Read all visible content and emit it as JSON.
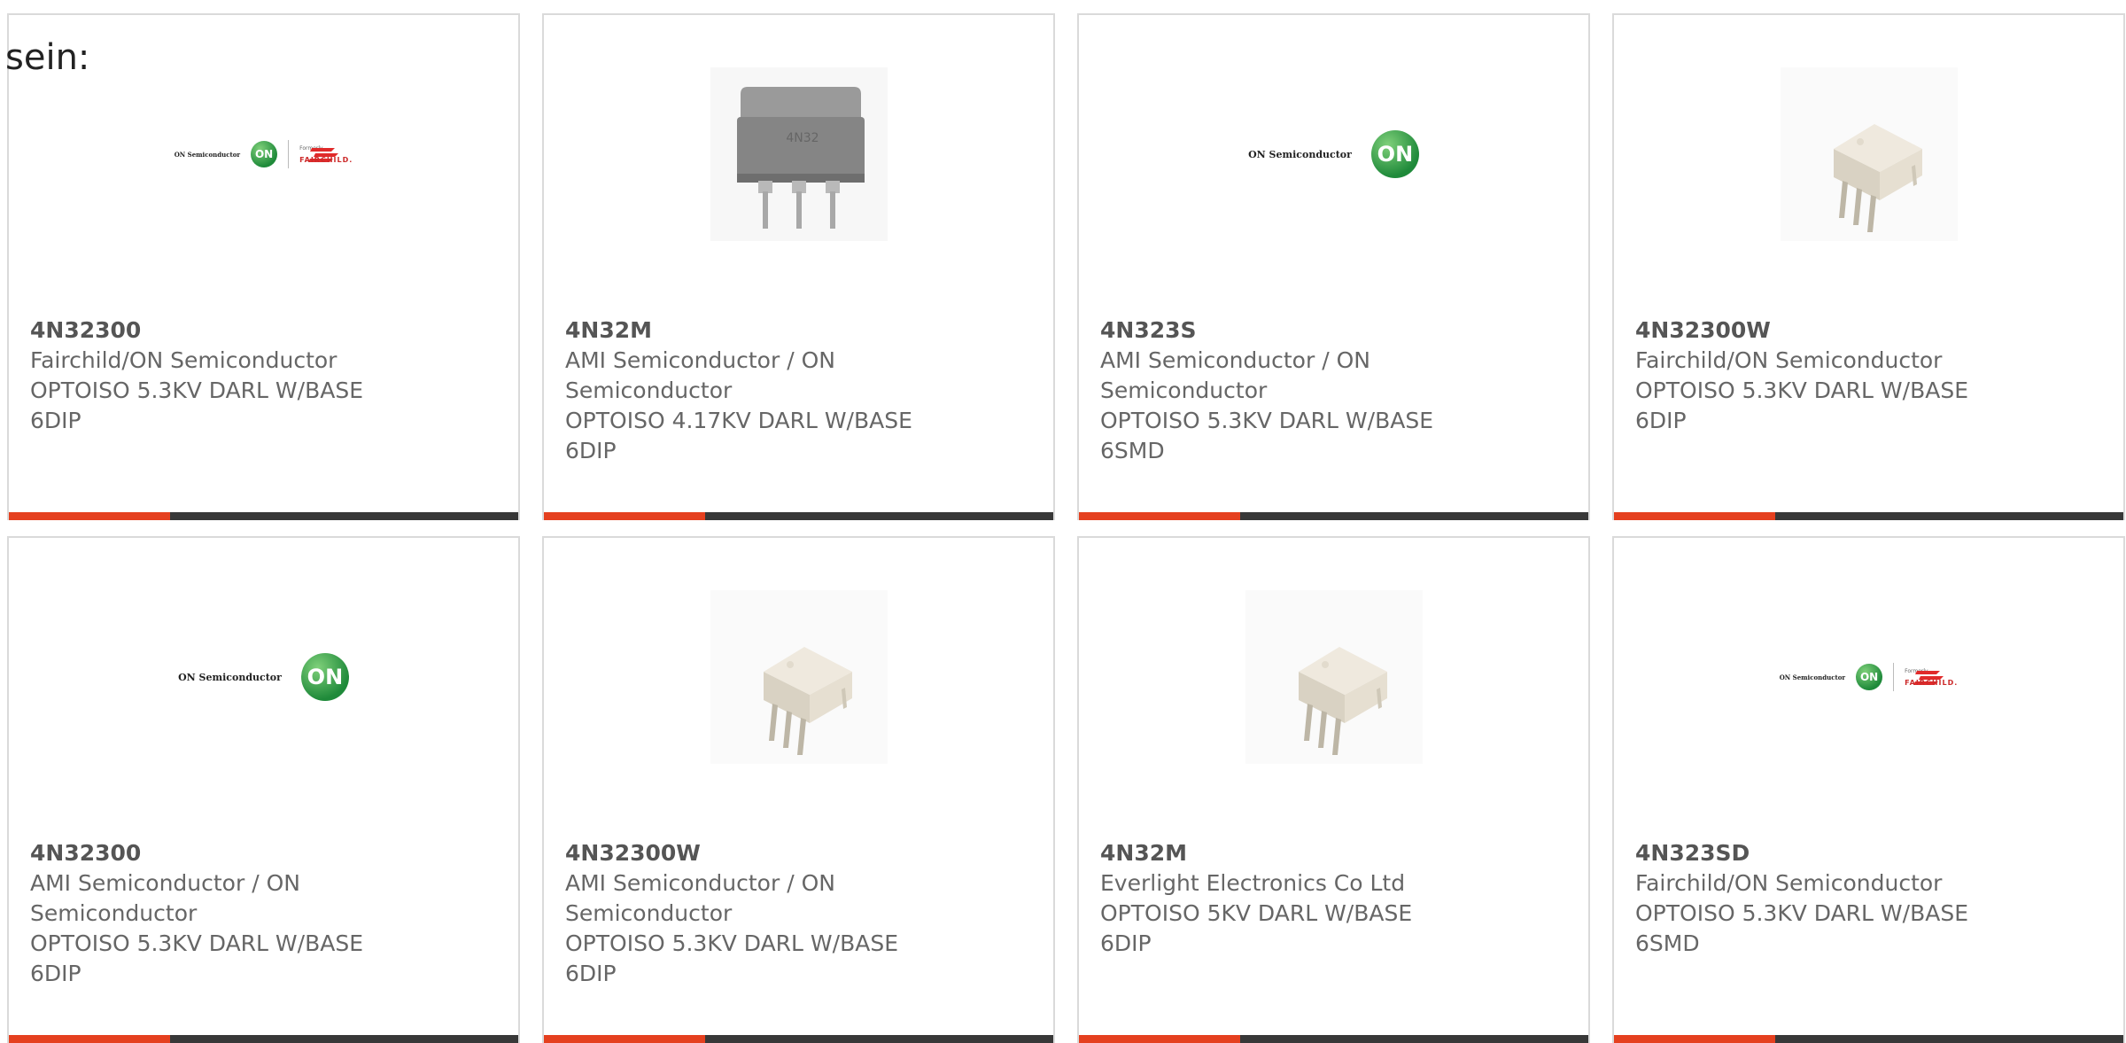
{
  "lead_text": "sein:",
  "colors": {
    "accent": "#e5401f",
    "bar": "#383838",
    "text": "#666666",
    "border": "#dadada"
  },
  "cards": [
    {
      "part": "4N32300",
      "maker": "Fairchild/ON Semiconductor",
      "maker_wrap": false,
      "desc": "OPTOISO 5.3KV DARL W/BASE",
      "pkg": "6DIP",
      "image": "on-fairchild-logo-image",
      "logo_semi": "ON Semiconductor",
      "logo_on": "ON",
      "logo_formerly": "Formerly",
      "logo_fairchild": "FAIRCHILD."
    },
    {
      "part": "4N32M",
      "maker": "AMI Semiconductor / ON Semiconductor",
      "maker_wrap": true,
      "maker_1": "AMI Semiconductor / ON",
      "maker_2": "Semiconductor",
      "desc": "OPTOISO 4.17KV DARL W/BASE",
      "pkg": "6DIP",
      "image": "dip6-gray-chip-image",
      "chip_label": "4N32"
    },
    {
      "part": "4N323S",
      "maker": "AMI Semiconductor / ON Semiconductor",
      "maker_wrap": true,
      "maker_1": "AMI Semiconductor / ON",
      "maker_2": "Semiconductor",
      "desc": "OPTOISO 5.3KV DARL W/BASE",
      "pkg": "6SMD",
      "image": "on-semiconductor-logo-image",
      "logo_semi": "ON Semiconductor",
      "logo_on": "ON"
    },
    {
      "part": "4N32300W",
      "maker": "Fairchild/ON Semiconductor",
      "maker_wrap": false,
      "desc": "OPTOISO 5.3KV DARL W/BASE",
      "pkg": "6DIP",
      "image": "dip6-white-chip-image"
    },
    {
      "part": "4N32300",
      "maker": "AMI Semiconductor / ON Semiconductor",
      "maker_wrap": true,
      "maker_1": "AMI Semiconductor / ON",
      "maker_2": "Semiconductor",
      "desc": "OPTOISO 5.3KV DARL W/BASE",
      "pkg": "6DIP",
      "image": "on-semiconductor-logo-image",
      "logo_semi": "ON Semiconductor",
      "logo_on": "ON"
    },
    {
      "part": "4N32300W",
      "maker": "AMI Semiconductor / ON Semiconductor",
      "maker_wrap": true,
      "maker_1": "AMI Semiconductor / ON",
      "maker_2": "Semiconductor",
      "desc": "OPTOISO 5.3KV DARL W/BASE",
      "pkg": "6DIP",
      "image": "dip6-white-chip-image"
    },
    {
      "part": "4N32M",
      "maker": "Everlight Electronics Co Ltd",
      "maker_wrap": false,
      "desc": "OPTOISO 5KV DARL W/BASE",
      "pkg": "6DIP",
      "image": "dip6-white-chip-image"
    },
    {
      "part": "4N323SD",
      "maker": "Fairchild/ON Semiconductor",
      "maker_wrap": false,
      "desc": "OPTOISO 5.3KV DARL W/BASE",
      "pkg": "6SMD",
      "image": "on-fairchild-logo-image",
      "logo_semi": "ON Semiconductor",
      "logo_on": "ON",
      "logo_formerly": "Formerly",
      "logo_fairchild": "FAIRCHILD."
    }
  ]
}
